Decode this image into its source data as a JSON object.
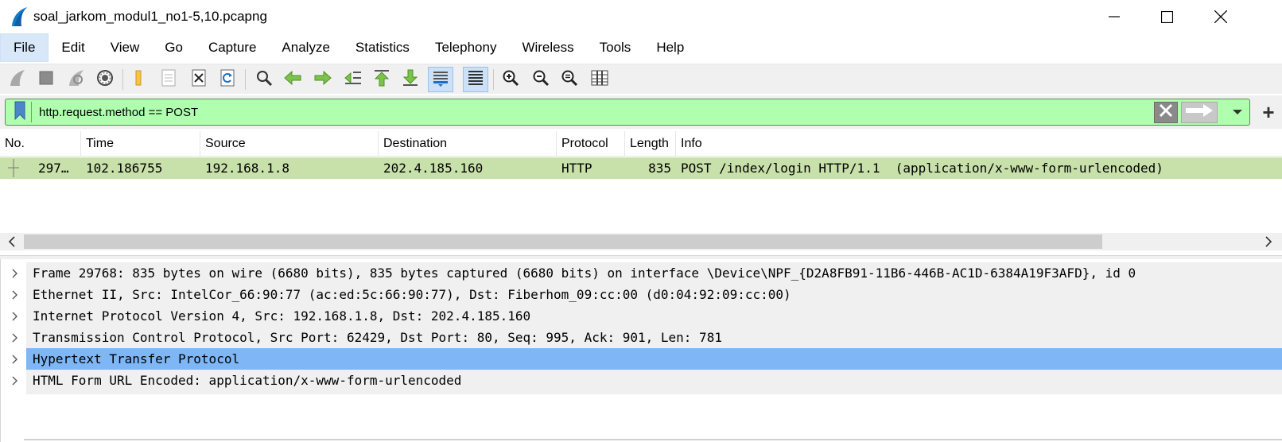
{
  "window": {
    "title": "soal_jarkom_modul1_no1-5,10.pcapng",
    "icon": "wireshark-fin-icon",
    "controls": [
      "minimize-icon",
      "maximize-icon",
      "close-icon"
    ]
  },
  "menu": {
    "items": [
      "File",
      "Edit",
      "View",
      "Go",
      "Capture",
      "Analyze",
      "Statistics",
      "Telephony",
      "Wireless",
      "Tools",
      "Help"
    ],
    "active": "File"
  },
  "toolbar": {
    "buttons": [
      "start-capture-icon",
      "stop-capture-icon",
      "restart-capture-icon",
      "capture-options-icon",
      "open-file-icon",
      "save-file-icon",
      "close-file-icon",
      "reload-file-icon",
      "find-packet-icon",
      "go-back-icon",
      "go-forward-icon",
      "go-to-packet-icon",
      "go-first-icon",
      "go-last-icon",
      "autoscroll-icon",
      "colorize-icon",
      "zoom-in-icon",
      "zoom-out-icon",
      "normal-size-icon",
      "resize-columns-icon"
    ],
    "pressed": [
      "autoscroll-icon",
      "colorize-icon"
    ]
  },
  "filter": {
    "value": "http.request.method == POST",
    "background": "#afffaf"
  },
  "packet_list": {
    "columns": [
      "No.",
      "Time",
      "Source",
      "Destination",
      "Protocol",
      "Length",
      "Info"
    ],
    "rows": [
      {
        "no": "297…",
        "time": "102.186755",
        "source": "192.168.1.8",
        "destination": "202.4.185.160",
        "protocol": "HTTP",
        "length": "835",
        "info": "POST /index/login HTTP/1.1  (application/x-www-form-urlencoded)",
        "color": "#c8e0aa"
      }
    ]
  },
  "details": {
    "items": [
      {
        "text": "Frame 29768: 835 bytes on wire (6680 bits), 835 bytes captured (6680 bits) on interface \\Device\\NPF_{D2A8FB91-11B6-446B-AC1D-6384A19F3AFD}, id 0",
        "selected": false
      },
      {
        "text": "Ethernet II, Src: IntelCor_66:90:77 (ac:ed:5c:66:90:77), Dst: Fiberhom_09:cc:00 (d0:04:92:09:cc:00)",
        "selected": false
      },
      {
        "text": "Internet Protocol Version 4, Src: 192.168.1.8, Dst: 202.4.185.160",
        "selected": false
      },
      {
        "text": "Transmission Control Protocol, Src Port: 62429, Dst Port: 80, Seq: 995, Ack: 901, Len: 781",
        "selected": false
      },
      {
        "text": "Hypertext Transfer Protocol",
        "selected": true
      },
      {
        "text": "HTML Form URL Encoded: application/x-www-form-urlencoded",
        "selected": false
      }
    ],
    "selected_color": "#7eb6f6"
  }
}
